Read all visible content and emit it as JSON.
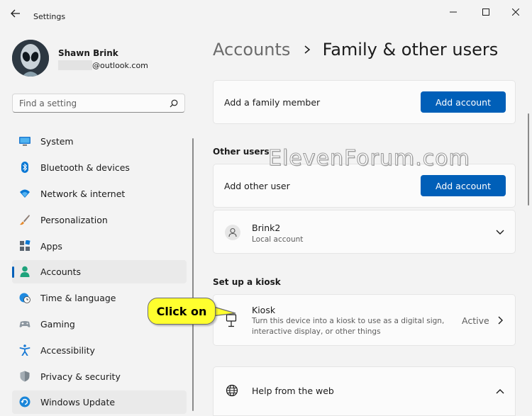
{
  "window": {
    "title": "Settings"
  },
  "profile": {
    "name": "Shawn Brink",
    "email": "@outlook.com"
  },
  "search": {
    "placeholder": "Find a setting"
  },
  "sidebar": {
    "items": [
      {
        "label": "System",
        "icon": "system-icon"
      },
      {
        "label": "Bluetooth & devices",
        "icon": "bluetooth-icon"
      },
      {
        "label": "Network & internet",
        "icon": "wifi-icon"
      },
      {
        "label": "Personalization",
        "icon": "brush-icon"
      },
      {
        "label": "Apps",
        "icon": "apps-icon"
      },
      {
        "label": "Accounts",
        "icon": "person-icon"
      },
      {
        "label": "Time & language",
        "icon": "globe-clock-icon"
      },
      {
        "label": "Gaming",
        "icon": "gamepad-icon"
      },
      {
        "label": "Accessibility",
        "icon": "accessibility-icon"
      },
      {
        "label": "Privacy & security",
        "icon": "shield-icon"
      },
      {
        "label": "Windows Update",
        "icon": "update-icon"
      }
    ]
  },
  "header": {
    "parent": "Accounts",
    "current": "Family & other users"
  },
  "family": {
    "label": "Add a family member",
    "button": "Add account"
  },
  "other_users": {
    "heading": "Other users",
    "label": "Add other user",
    "button": "Add account",
    "user": {
      "name": "Brink2",
      "type": "Local account"
    }
  },
  "kiosk": {
    "heading": "Set up a kiosk",
    "title": "Kiosk",
    "description_line1": "Turn this device into a kiosk to use as a digital sign,",
    "description_line2": "interactive display, or other things",
    "status": "Active"
  },
  "help": {
    "label": "Help from the web"
  },
  "watermark": "ElevenForum.com",
  "callout": "Click on",
  "colors": {
    "accent": "#005fb8",
    "background": "#f3f3f3",
    "card": "#fbfbfb",
    "callout": "#ffff2e"
  }
}
